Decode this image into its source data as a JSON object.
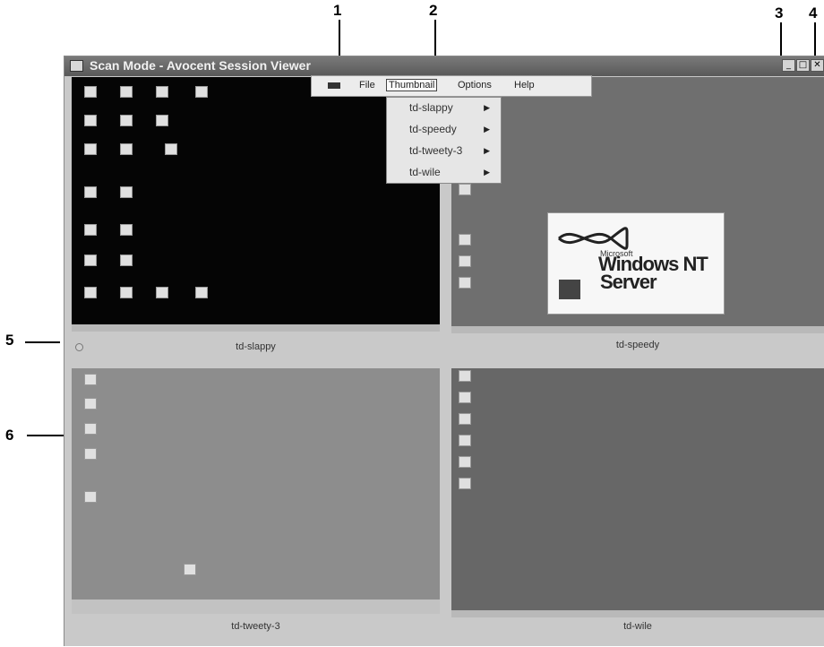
{
  "callouts": [
    "1",
    "2",
    "3",
    "4",
    "5",
    "6"
  ],
  "window": {
    "title": "Scan Mode - Avocent Session Viewer",
    "buttons": {
      "minimize": "_",
      "maximize": "□",
      "close": "✕"
    }
  },
  "menubar": {
    "items": [
      {
        "label": "File"
      },
      {
        "label": "Thumbnail"
      },
      {
        "label": "Options"
      },
      {
        "label": "Help"
      }
    ]
  },
  "thumbnail_menu": {
    "items": [
      {
        "label": "td-slappy",
        "arrow": "▶"
      },
      {
        "label": "td-speedy",
        "arrow": "▶"
      },
      {
        "label": "td-tweety-3",
        "arrow": "▶"
      },
      {
        "label": "td-wile",
        "arrow": "▶"
      }
    ]
  },
  "splash": {
    "brand": "Microsoft",
    "line1": "Windows NT",
    "line2": "Server"
  },
  "thumbnails": [
    {
      "label": "td-slappy"
    },
    {
      "label": "td-speedy"
    },
    {
      "label": "td-tweety-3"
    },
    {
      "label": "td-wile"
    }
  ]
}
